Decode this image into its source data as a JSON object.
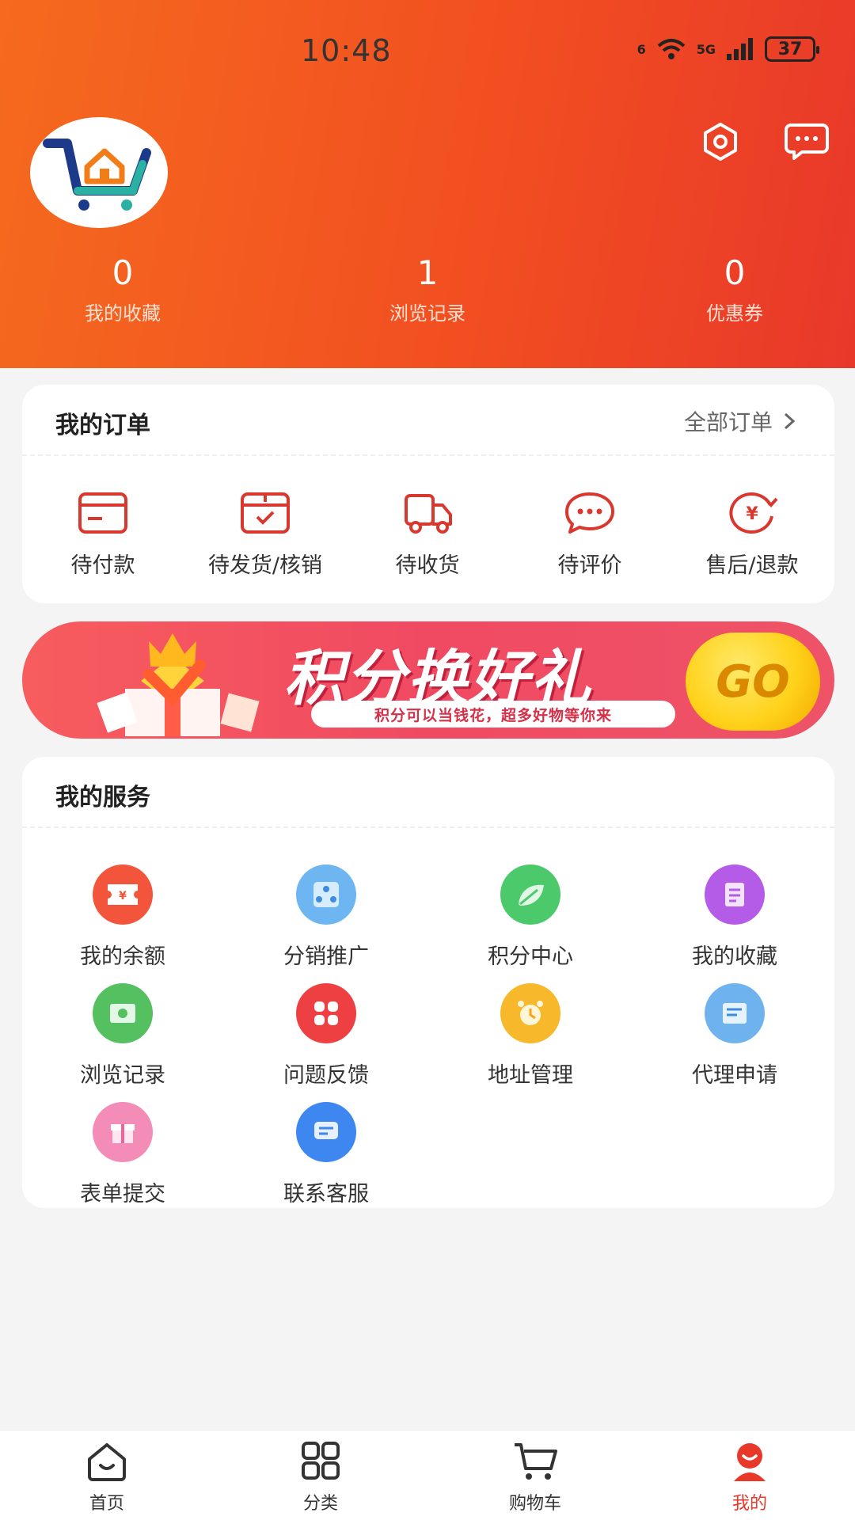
{
  "status_bar": {
    "time": "10:48",
    "network": "5G",
    "signal_label": "6",
    "battery": "37"
  },
  "header": {
    "stats": [
      {
        "value": "0",
        "label": "我的收藏"
      },
      {
        "value": "1",
        "label": "浏览记录"
      },
      {
        "value": "0",
        "label": "优惠券"
      }
    ],
    "icons": [
      "settings-icon",
      "message-icon"
    ]
  },
  "orders": {
    "title": "我的订单",
    "all_link": "全部订单",
    "items": [
      {
        "label": "待付款",
        "icon": "wallet-icon"
      },
      {
        "label": "待发货/核销",
        "icon": "package-check-icon"
      },
      {
        "label": "待收货",
        "icon": "truck-icon"
      },
      {
        "label": "待评价",
        "icon": "comment-icon"
      },
      {
        "label": "售后/退款",
        "icon": "refund-icon"
      }
    ]
  },
  "banner": {
    "title": "积分换好礼",
    "subtitle": "积分可以当钱花，超多好物等你来",
    "button": "GO"
  },
  "services": {
    "title": "我的服务",
    "items": [
      {
        "label": "我的余额",
        "icon": "ticket-icon",
        "color": "#f2553b"
      },
      {
        "label": "分销推广",
        "icon": "distribution-icon",
        "color": "#6db6f2"
      },
      {
        "label": "积分中心",
        "icon": "leaf-icon",
        "color": "#4cc96a"
      },
      {
        "label": "我的收藏",
        "icon": "document-icon",
        "color": "#b45ce8"
      },
      {
        "label": "浏览记录",
        "icon": "money-icon",
        "color": "#54c060"
      },
      {
        "label": "问题反馈",
        "icon": "grid-icon",
        "color": "#ee3f43"
      },
      {
        "label": "地址管理",
        "icon": "alarm-icon",
        "color": "#f7b82b"
      },
      {
        "label": "代理申请",
        "icon": "form-icon",
        "color": "#6fb3ee"
      },
      {
        "label": "表单提交",
        "icon": "gift-icon",
        "color": "#f48cb8"
      },
      {
        "label": "联系客服",
        "icon": "chat-icon",
        "color": "#3e86f0"
      }
    ]
  },
  "tabbar": {
    "items": [
      {
        "label": "首页",
        "icon": "home-icon"
      },
      {
        "label": "分类",
        "icon": "category-icon"
      },
      {
        "label": "购物车",
        "icon": "cart-icon"
      },
      {
        "label": "我的",
        "icon": "profile-icon"
      }
    ],
    "active": "我的",
    "active_color": "#e8382a"
  }
}
